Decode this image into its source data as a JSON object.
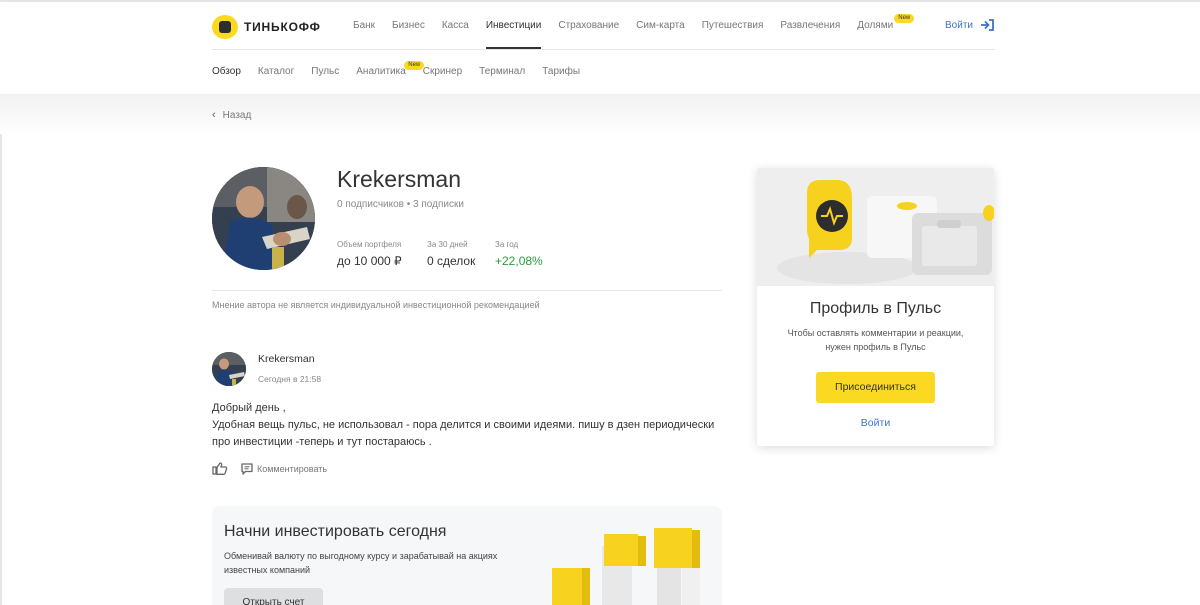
{
  "header": {
    "logo_text": "ТИНЬКОФФ",
    "nav": [
      {
        "label": "Банк",
        "active": false
      },
      {
        "label": "Бизнес",
        "active": false
      },
      {
        "label": "Касса",
        "active": false
      },
      {
        "label": "Инвестиции",
        "active": true
      },
      {
        "label": "Страхование",
        "active": false
      },
      {
        "label": "Сим-карта",
        "active": false
      },
      {
        "label": "Путешествия",
        "active": false
      },
      {
        "label": "Развлечения",
        "active": false
      },
      {
        "label": "Долями",
        "active": false,
        "badge": "New"
      }
    ],
    "login_label": "Войти"
  },
  "subnav": [
    {
      "label": "Обзор",
      "active": true
    },
    {
      "label": "Каталог",
      "active": false
    },
    {
      "label": "Пульс",
      "active": false
    },
    {
      "label": "Аналитика",
      "active": false,
      "badge": "New"
    },
    {
      "label": "Скринер",
      "active": false
    },
    {
      "label": "Терминал",
      "active": false
    },
    {
      "label": "Тарифы",
      "active": false
    }
  ],
  "back_label": "Назад",
  "profile": {
    "username": "Krekersman",
    "subscribers_text": "0 подписчиков • 3 подписки",
    "stats": [
      {
        "label": "Объем портфеля",
        "value": "до 10 000 ₽",
        "positive": false
      },
      {
        "label": "За 30 дней",
        "value": "0 сделок",
        "positive": false
      },
      {
        "label": "За год",
        "value": "+22,08%",
        "positive": true
      }
    ],
    "disclaimer": "Мнение автора не является индивидуальной инвестиционной рекомендацией"
  },
  "post": {
    "author": "Krekersman",
    "time": "Сегодня в 21:58",
    "lines": [
      "Добрый день ,",
      "Удобная вещь пульс,  не использовал - пора делится и своими идеями. пишу в дзен периодически",
      "про инвестиции -теперь и тут постараюсь ."
    ],
    "comment_label": "Комментировать"
  },
  "promo": {
    "title": "Начни инвестировать сегодня",
    "text": "Обменивай валюту по выгодному курсу и зарабатывай на акциях известных компаний",
    "button_label": "Открыть счет"
  },
  "side_card": {
    "title": "Профиль в Пульс",
    "text_line1": "Чтобы оставлять комментарии и реакции,",
    "text_line2": "нужен профиль в Пульс",
    "join_label": "Присоединиться",
    "login_label": "Войти"
  },
  "colors": {
    "brand_yellow": "#fbd923",
    "link_blue": "#3d73c5",
    "positive_green": "#2c9a3c"
  }
}
